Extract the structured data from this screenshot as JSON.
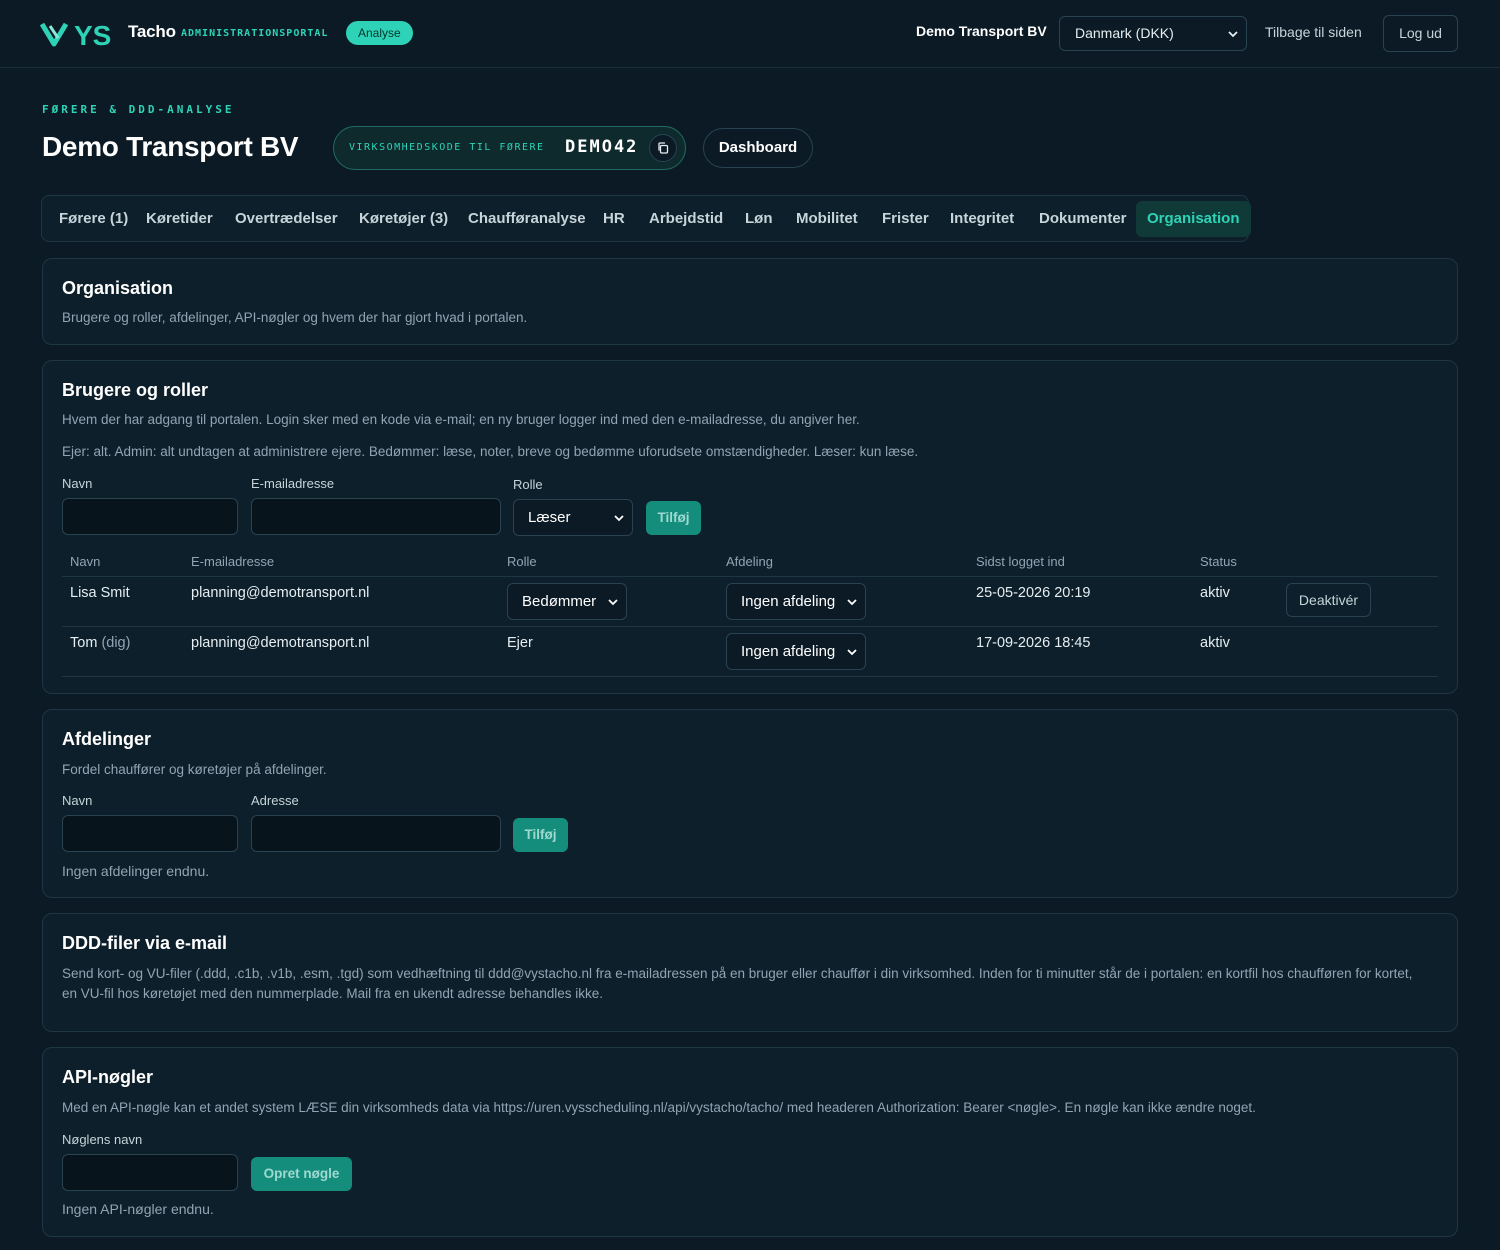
{
  "header": {
    "logo_text": "VYS",
    "brand": "Tacho",
    "brand_sub": "ADMINISTRATIONSPORTAL",
    "badge": "Analyse",
    "company": "Demo Transport BV",
    "country_selected": "Danmark (DKK)",
    "back_link": "Tilbage til siden",
    "logout": "Log ud"
  },
  "page": {
    "eyebrow": "FØRERE & DDD-ANALYSE",
    "title": "Demo Transport BV",
    "code_label": "VIRKSOMHEDSKODE TIL FØRERE",
    "code_value": "DEMO42",
    "dashboard_button": "Dashboard"
  },
  "tabs": [
    {
      "label": "Førere (1)"
    },
    {
      "label": "Køretider"
    },
    {
      "label": "Overtrædelser"
    },
    {
      "label": "Køretøjer (3)"
    },
    {
      "label": "Chaufføranalyse"
    },
    {
      "label": "HR"
    },
    {
      "label": "Arbejdstid"
    },
    {
      "label": "Løn"
    },
    {
      "label": "Mobilitet"
    },
    {
      "label": "Frister"
    },
    {
      "label": "Integritet"
    },
    {
      "label": "Dokumenter"
    },
    {
      "label": "Organisation",
      "active": true
    }
  ],
  "organisation": {
    "title": "Organisation",
    "text": "Brugere og roller, afdelinger, API-nøgler og hvem der har gjort hvad i portalen."
  },
  "users": {
    "title": "Brugere og roller",
    "text1": "Hvem der har adgang til portalen. Login sker med en kode via e-mail; en ny bruger logger ind med den e-mailadresse, du angiver her.",
    "text2": "Ejer: alt. Admin: alt undtagen at administrere ejere. Bedømmer: læse, noter, breve og bedømme uforudsete omstændigheder. Læser: kun læse.",
    "form": {
      "name_label": "Navn",
      "email_label": "E-mailadresse",
      "role_label": "Rolle",
      "role_selected": "Læser",
      "add_button": "Tilføj"
    },
    "columns": [
      "Navn",
      "E-mailadresse",
      "Rolle",
      "Afdeling",
      "Sidst logget ind",
      "Status"
    ],
    "rows": [
      {
        "name": "Lisa Smit",
        "suffix": "",
        "email": "planning@demotransport.nl",
        "role": "Bedømmer",
        "department": "Ingen afdeling",
        "last_login": "25-05-2026 20:19",
        "status": "aktiv",
        "action": "Deaktivér"
      },
      {
        "name": "Tom",
        "suffix": "(dig)",
        "email": "planning@demotransport.nl",
        "role": "Ejer",
        "department": "Ingen afdeling",
        "last_login": "17-09-2026 18:45",
        "status": "aktiv"
      }
    ]
  },
  "departments": {
    "title": "Afdelinger",
    "text": "Fordel chauffører og køretøjer på afdelinger.",
    "name_label": "Navn",
    "address_label": "Adresse",
    "add_button": "Tilføj",
    "empty": "Ingen afdelinger endnu."
  },
  "ddd_mail": {
    "title": "DDD-filer via e-mail",
    "text1": "Send kort- og VU-filer (.ddd, .c1b, .v1b, .esm, .tgd) som vedhæftning til ddd@vystacho.nl fra e-mailadressen på en bruger eller chauffør i din virksomhed. Inden for ti minutter står de i portalen: en kortfil hos chaufføren for kortet,",
    "text2": "en VU-fil hos køretøjet med den nummerplade. Mail fra en ukendt adresse behandles ikke."
  },
  "api_keys": {
    "title": "API-nøgler",
    "text": "Med en API-nøgle kan et andet system LÆSE din virksomheds data via https://uren.vysscheduling.nl/api/vystacho/tacho/ med headeren Authorization: Bearer <nøgle>. En nøgle kan ikke ændre noget.",
    "name_label": "Nøglens navn",
    "create_button": "Opret nøgle",
    "empty": "Ingen API-nøgler endnu."
  },
  "colors": {
    "accent": "#2ed3b7",
    "background": "#0b1a24",
    "card": "#0d1f2a"
  }
}
